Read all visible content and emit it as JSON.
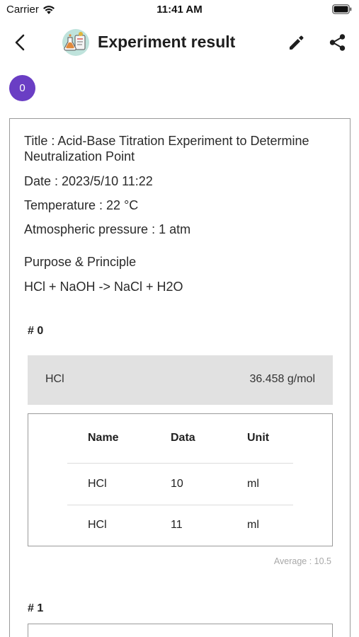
{
  "status_bar": {
    "carrier": "Carrier",
    "time": "11:41 AM"
  },
  "nav": {
    "title": "Experiment result",
    "back_icon": "chevron-left-icon",
    "edit_icon": "pencil-icon",
    "share_icon": "share-icon"
  },
  "badge": {
    "count": "0",
    "color": "#6a3ec4"
  },
  "experiment": {
    "title_line": "Title : Acid-Base Titration Experiment to Determine Neutralization Point",
    "date_line": "Date : 2023/5/10 11:22",
    "temperature_line": "Temperature : 22 °C",
    "pressure_line": "Atmospheric pressure : 1 atm",
    "purpose_label": "Purpose & Principle",
    "equation": "HCl + NaOH -> NaCl + H2O"
  },
  "sections": [
    {
      "label": "# 0",
      "compound": "HCl",
      "molar_mass": "36.458 g/mol",
      "headers": [
        "Name",
        "Data",
        "Unit"
      ],
      "rows": [
        [
          "HCl",
          "10",
          "ml"
        ],
        [
          "HCl",
          "11",
          "ml"
        ]
      ],
      "average": "Average : 10.5"
    },
    {
      "label": "# 1"
    }
  ]
}
